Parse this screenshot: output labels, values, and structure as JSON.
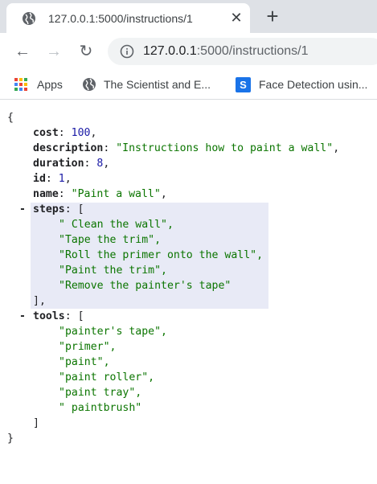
{
  "tab": {
    "title": "127.0.0.1:5000/instructions/1",
    "close_glyph": "✕",
    "new_tab_glyph": "+"
  },
  "toolbar": {
    "back_glyph": "←",
    "forward_glyph": "→",
    "reload_glyph": "↻",
    "url_host": "127.0.0.1",
    "url_path": ":5000/instructions/1"
  },
  "bookmarks": {
    "apps": "Apps",
    "scientist": "The Scientist and E...",
    "face": "Face Detection usin...",
    "face_icon_letter": "S",
    "apps_colors": [
      "#ea4335",
      "#fbbc04",
      "#34a853",
      "#4285f4",
      "#ea4335",
      "#fbbc04",
      "#34a853",
      "#4285f4",
      "#ea4335"
    ]
  },
  "json": {
    "open_brace": "{",
    "close_brace": "}",
    "cost_key": "cost",
    "cost_value": "100",
    "description_key": "description",
    "description_value": "\"Instructions how to paint a wall\"",
    "duration_key": "duration",
    "duration_value": "8",
    "id_key": "id",
    "id_value": "1",
    "name_key": "name",
    "name_value": "\"Paint a wall\"",
    "steps_key": "steps",
    "steps": [
      "\" Clean the wall\",",
      "\"Tape the trim\",",
      "\"Roll the primer onto the wall\",",
      "\"Paint the trim\",",
      "\"Remove the painter's tape\""
    ],
    "steps_close": "],",
    "tools_key": "tools",
    "tools": [
      "\"painter's tape\",",
      "\"primer\",",
      "\"paint\",",
      "\"paint roller\",",
      "\"paint tray\",",
      "\" paintbrush\""
    ],
    "tools_close": "]",
    "collapse_glyph": "-",
    "colon": ": ",
    "comma": ",",
    "open_bracket": "["
  }
}
